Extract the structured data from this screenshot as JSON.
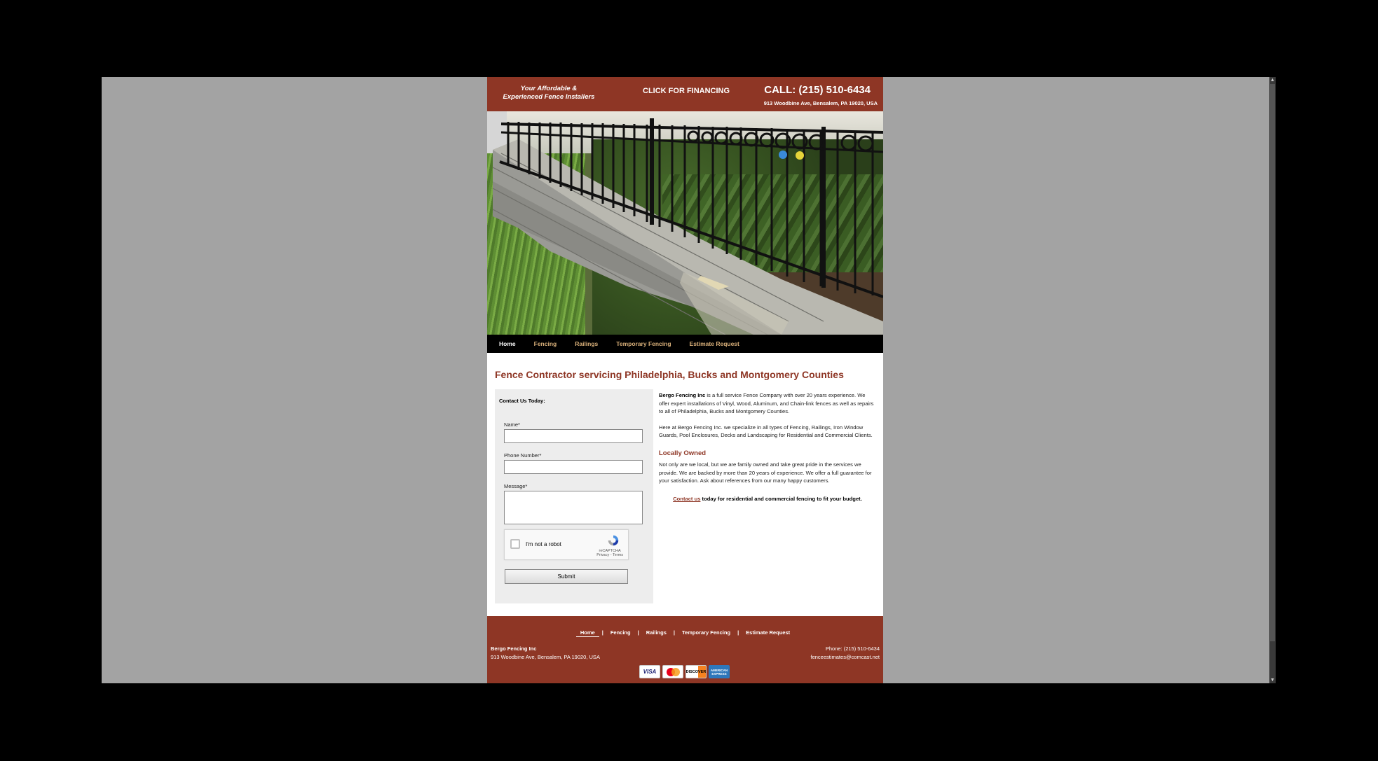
{
  "header": {
    "tagline_line1": "Your Affordable &",
    "tagline_line2": "Experienced Fence Installers",
    "financing": "CLICK FOR FINANCING",
    "call": "CALL: (215) 510-6434",
    "address": "913 Woodbine Ave, Bensalem, PA 19020, USA"
  },
  "nav": {
    "items": [
      "Home",
      "Fencing",
      "Railings",
      "Temporary Fencing",
      "Estimate Request"
    ]
  },
  "main": {
    "title": "Fence Contractor servicing Philadelphia, Bucks and Montgomery Counties",
    "form": {
      "heading": "Contact Us Today:",
      "name_label": "Name*",
      "phone_label": "Phone Number*",
      "message_label": "Message*",
      "captcha_label": "I'm not a robot",
      "captcha_brand": "reCAPTCHA",
      "captcha_links": "Privacy - Terms",
      "submit": "Submit"
    },
    "intro_bold": "Bergo Fencing Inc",
    "intro_rest": " is a full service Fence Company with over 20 years experience. We offer expert installations of Vinyl, Wood, Aluminum, and Chain-link fences as well as repairs to all of Philadelphia, Bucks and Montgomery Counties.",
    "para2": "Here at Bergo Fencing Inc. we specialize in all types of Fencing, Railings, Iron Window Guards, Pool Enclosures, Decks and Landscaping for Residential and Commercial Clients.",
    "subhead": "Locally Owned",
    "para3": "Not only are we local, but we are family owned and take great pride in the services we provide. We are backed by more than 20 years of experience. We offer a full guarantee for your satisfaction. Ask about references from our many happy customers.",
    "cta_link": "Contact us",
    "cta_rest": " today for residential and commercial fencing to fit your budget."
  },
  "footer": {
    "nav": [
      "Home",
      "Fencing",
      "Railings",
      "Temporary Fencing",
      "Estimate Request"
    ],
    "separator": "|",
    "company": "Bergo Fencing Inc",
    "address": "913 Woodbine Ave, Bensalem, PA  19020, USA",
    "phone": "Phone: (215) 510-6434",
    "email": "fenceestimates@comcast.net",
    "cards": {
      "visa": "VISA",
      "discover": "DISCOVER",
      "amex": "AMERICAN EXPRESS"
    }
  },
  "colors": {
    "brand": "#8e3625",
    "nav_bg": "#000000",
    "nav_link": "#d9b07a",
    "window_bg": "#a3a3a3"
  }
}
